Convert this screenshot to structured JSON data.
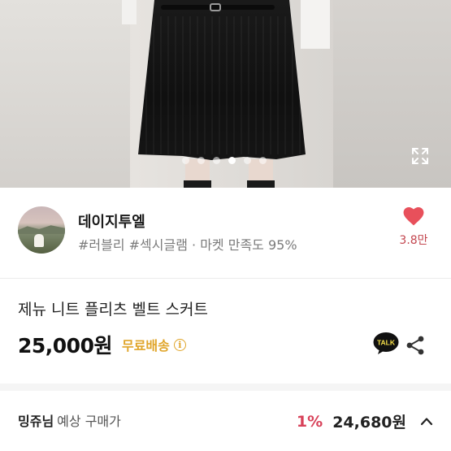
{
  "carousel": {
    "slide_count": 6,
    "active_index": 2
  },
  "seller": {
    "name": "데이지투엘",
    "tags": "#러블리 #섹시글램 · 마켓 만족도 95%",
    "likes": "3.8만"
  },
  "product": {
    "title": "제뉴 니트 플리츠 벨트 스커트",
    "price": "25,000원",
    "shipping": "무료배송",
    "talk_label": "TALK"
  },
  "estimate": {
    "name": "밍쥬님",
    "label": "예상 구매가",
    "percent": "1%",
    "price": "24,680원"
  },
  "colors": {
    "heart": "#e8505b",
    "free_shipping": "#e0a52a",
    "percent": "#d8425a"
  },
  "icons": [
    "expand-icon",
    "heart-icon",
    "info-icon",
    "kakao-talk-icon",
    "share-icon",
    "chevron-up-icon"
  ]
}
